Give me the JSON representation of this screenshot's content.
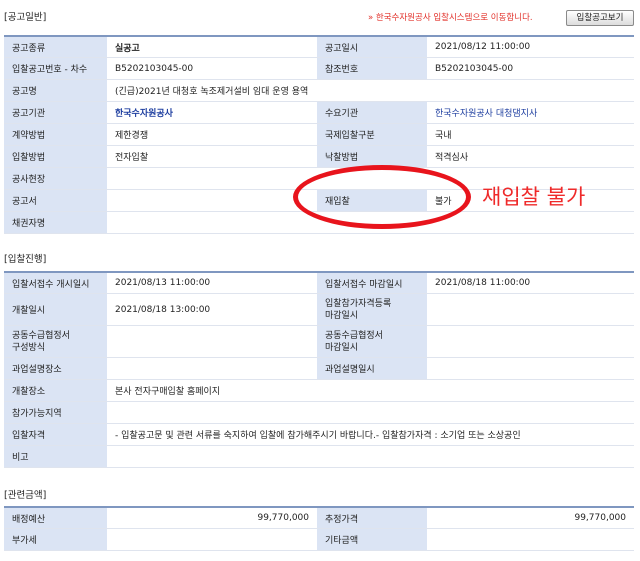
{
  "sections": {
    "general": "[공고일반]",
    "bidding": "[입찰진행]",
    "amounts": "[관련금액]"
  },
  "header": {
    "notice": "» 한국수자원공사 입찰시스템으로 이동합니다.",
    "button_label": "입찰공고보기"
  },
  "general": {
    "type_label": "공고종류",
    "type_value": "실공고",
    "date_label": "공고일시",
    "date_value": "2021/08/12 11:00:00",
    "num_label": "입찰공고번호 - 차수",
    "num_value": "B5202103045-00",
    "ref_label": "참조번호",
    "ref_value": "B5202103045-00",
    "name_label": "공고명",
    "name_value": "(긴급)2021년 대청호 녹조제거설비 임대 운영 용역",
    "org_label": "공고기관",
    "org_value": "한국수자원공사",
    "demand_label": "수요기관",
    "demand_value": "한국수자원공사 대청댐지사",
    "contract_label": "계약방법",
    "contract_value": "제한경쟁",
    "intl_label": "국제입찰구분",
    "intl_value": "국내",
    "bidway_label": "입찰방법",
    "bidway_value": "전자입찰",
    "award_label": "낙찰방법",
    "award_value": "적격심사",
    "site_label": "공사현장",
    "site_value": "",
    "doc_label": "공고서",
    "doc_value": "",
    "rebid_label": "재입찰",
    "rebid_value": "불가",
    "creditor_label": "채권자명",
    "creditor_value": ""
  },
  "bidding": {
    "open_label": "입찰서접수 개시일시",
    "open_value": "2021/08/13 11:00:00",
    "close_label": "입찰서접수 마감일시",
    "close_value": "2021/08/18 11:00:00",
    "opening_label": "개찰일시",
    "opening_value": "2021/08/18 13:00:00",
    "qual_deadline_label": "입찰참가자격등록\n마감일시",
    "qual_deadline_value": "",
    "joint_method_label": "공동수급협정서\n구성방식",
    "joint_method_value": "",
    "joint_deadline_label": "공동수급협정서\n마감일시",
    "joint_deadline_value": "",
    "briefing_place_label": "과업설명장소",
    "briefing_place_value": "",
    "briefing_date_label": "과업설명일시",
    "briefing_date_value": "",
    "opening_place_label": "개찰장소",
    "opening_place_value": "본사 전자구매입찰 홈페이지",
    "region_label": "참가가능지역",
    "region_value": "",
    "qualification_label": "입찰자격",
    "qualification_value": "- 입찰공고문 및 관련 서류를 숙지하여 입찰에 참가해주시기 바랍니다.- 입찰참가자격 : 소기업 또는 소상공인",
    "remarks_label": "비고",
    "remarks_value": ""
  },
  "amounts": {
    "budget_label": "배정예산",
    "budget_value": "99,770,000",
    "estimate_label": "추정가격",
    "estimate_value": "99,770,000",
    "vat_label": "부가세",
    "vat_value": "",
    "other_label": "기타금액",
    "other_value": ""
  },
  "annotation": {
    "text": "재입찰 불가",
    "color": "#e8141c"
  }
}
